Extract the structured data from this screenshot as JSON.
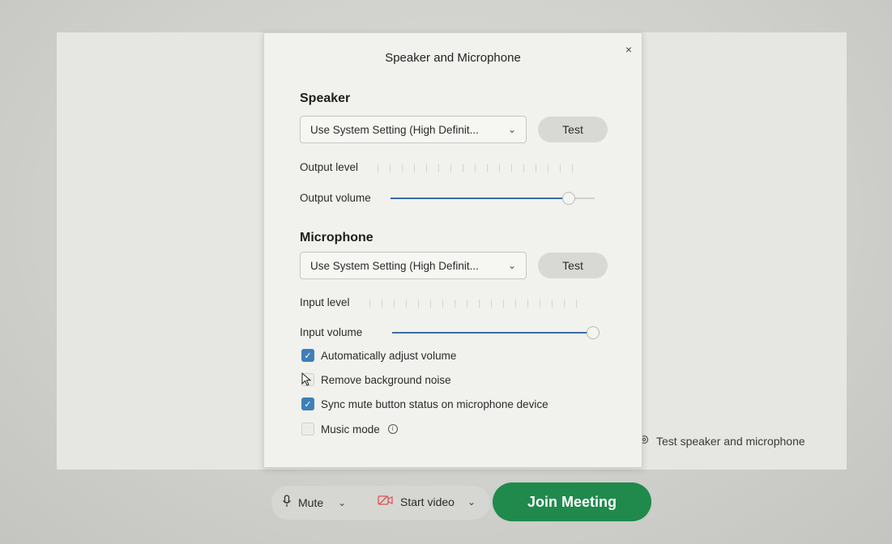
{
  "dialog": {
    "title": "Speaker and Microphone",
    "close_glyph": "×",
    "speaker": {
      "heading": "Speaker",
      "device": "Use System Setting (High Definit...",
      "test_label": "Test",
      "output_level_label": "Output level",
      "output_volume_label": "Output volume",
      "output_volume_level": 0.9
    },
    "microphone": {
      "heading": "Microphone",
      "device": "Use System Setting (High Definit...",
      "test_label": "Test",
      "input_level_label": "Input level",
      "input_volume_label": "Input volume",
      "input_volume_level": 1.0
    },
    "options": [
      {
        "label": "Automatically adjust volume",
        "checked": true
      },
      {
        "label": "Remove background noise",
        "checked": false
      },
      {
        "label": "Sync mute button status on microphone device",
        "checked": true
      },
      {
        "label": "Music mode",
        "checked": false
      }
    ]
  },
  "stage": {
    "test_link": "Test speaker and microphone"
  },
  "toolbar": {
    "mute_label": "Mute",
    "video_label": "Start video",
    "join_label": "Join Meeting"
  },
  "icons": {
    "chevron": "⌄",
    "check": "✓",
    "info": "i"
  },
  "colors": {
    "join": "#1f8a4c",
    "slider_fill": "#3a6ea5",
    "checkbox_on": "#3f7fb8",
    "video_icon": "#d9534f"
  }
}
